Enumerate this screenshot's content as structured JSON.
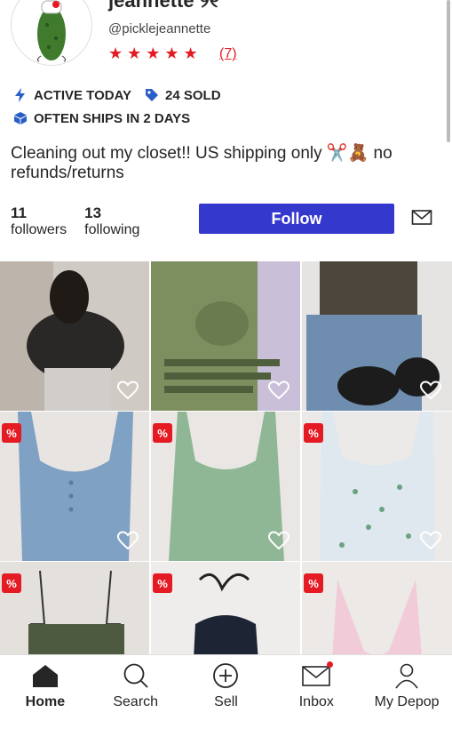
{
  "profile": {
    "display_name": "jeannette ୨୧",
    "username": "@picklejeannette",
    "stars": "★★★★★",
    "review_count": "(7)",
    "badges": {
      "active": "ACTIVE TODAY",
      "sold": "24 SOLD",
      "ships": "OFTEN SHIPS IN 2 DAYS"
    },
    "bio": "Cleaning out my closet!! US shipping only ✂️🧸 no refunds/returns",
    "followers_count": "11",
    "followers_label": "followers",
    "following_count": "13",
    "following_label": "following",
    "follow_label": "Follow"
  },
  "grid": {
    "sale_badge": "%",
    "items": [
      {
        "desc": "black puffer jacket photo",
        "sale": false
      },
      {
        "desc": "green graphic tee",
        "sale": false
      },
      {
        "desc": "camo top with jeans",
        "sale": false
      },
      {
        "desc": "blue ribbed tank",
        "sale": true
      },
      {
        "desc": "green lace tank",
        "sale": true
      },
      {
        "desc": "floral tank",
        "sale": true
      },
      {
        "desc": "olive cami",
        "sale": true
      },
      {
        "desc": "navy halter",
        "sale": true
      },
      {
        "desc": "pink halter",
        "sale": true
      }
    ]
  },
  "tabbar": {
    "home": "Home",
    "search": "Search",
    "sell": "Sell",
    "inbox": "Inbox",
    "mydepop": "My Depop"
  },
  "colors": {
    "accent": "#3538cd",
    "rating": "#e51b23",
    "badge_icon": "#2a5ec7"
  }
}
